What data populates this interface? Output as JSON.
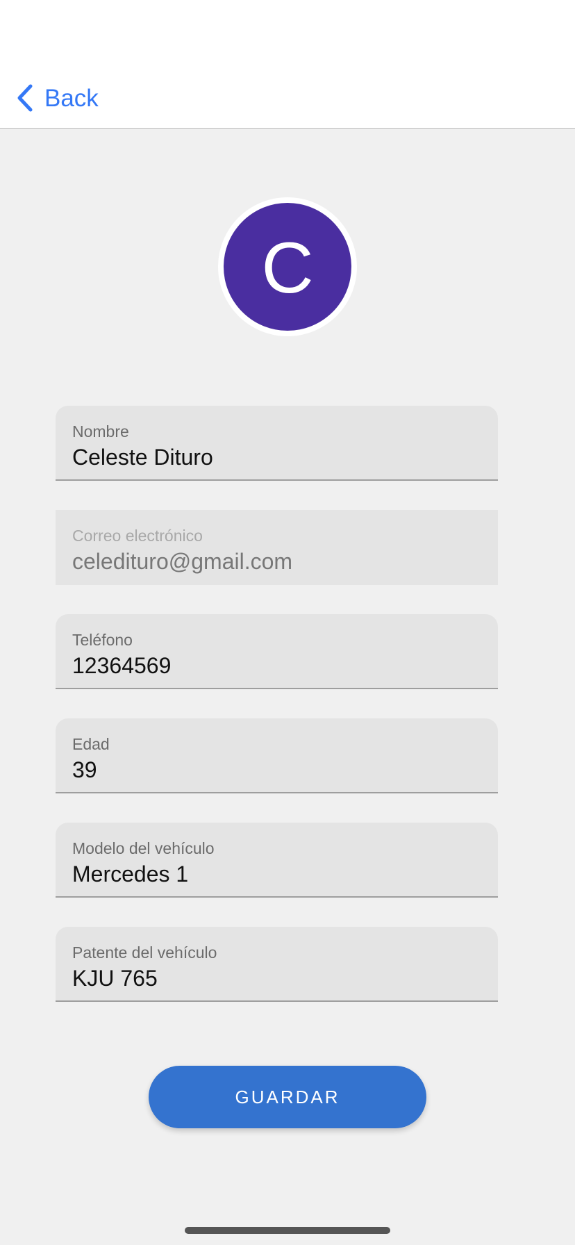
{
  "nav": {
    "back_label": "Back",
    "accent_color": "#3478f6"
  },
  "avatar": {
    "initial": "C",
    "color": "#4a2ea0"
  },
  "fields": [
    {
      "label": "Nombre",
      "value": "Celeste Dituro",
      "editable": true
    },
    {
      "label": "Correo electrónico",
      "value": "celedituro@gmail.com",
      "editable": false
    },
    {
      "label": "Teléfono",
      "value": "12364569",
      "editable": true
    },
    {
      "label": "Edad",
      "value": "39",
      "editable": true
    },
    {
      "label": "Modelo del vehículo",
      "value": "Mercedes 1",
      "editable": true
    },
    {
      "label": "Patente del vehículo",
      "value": "KJU 765",
      "editable": true
    }
  ],
  "save": {
    "label": "GUARDAR",
    "color": "#3473cf"
  },
  "icons": {
    "back": "chevron-left-icon"
  }
}
